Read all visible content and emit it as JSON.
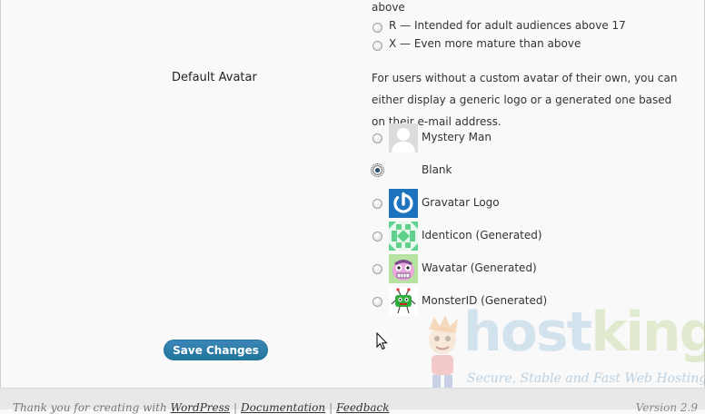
{
  "ratings": {
    "prev_line": "above",
    "options": [
      {
        "label": "R — Intended for adult audiences above 17",
        "checked": false
      },
      {
        "label": "X — Even more mature than above",
        "checked": false
      }
    ]
  },
  "default_avatar": {
    "label": "Default Avatar",
    "description": "For users without a custom avatar of their own, you can either display a generic logo or a generated one based on their e-mail address.",
    "options": [
      {
        "label": "Mystery Man",
        "icon": "mystery-man-icon",
        "checked": false
      },
      {
        "label": "Blank",
        "icon": "blank-icon",
        "checked": true
      },
      {
        "label": "Gravatar Logo",
        "icon": "gravatar-logo-icon",
        "checked": false
      },
      {
        "label": "Identicon (Generated)",
        "icon": "identicon-icon",
        "checked": false
      },
      {
        "label": "Wavatar (Generated)",
        "icon": "wavatar-icon",
        "checked": false
      },
      {
        "label": "MonsterID (Generated)",
        "icon": "monsterid-icon",
        "checked": false
      }
    ]
  },
  "save_button": "Save Changes",
  "watermark": {
    "brand_a": "host",
    "brand_b": "king",
    "tagline": "Secure, Stable and Fast Web Hosting"
  },
  "footer": {
    "prefix": "Thank you for creating with",
    "wordpress": "WordPress",
    "sep1": "|",
    "documentation": "Documentation",
    "sep2": "|",
    "feedback": "Feedback",
    "version": "Version 2.9"
  },
  "colors": {
    "button": "#21759b",
    "background": "#f9f9f9",
    "gravatar_blue": "#1e73be",
    "identicon_green": "#5fd18c"
  }
}
